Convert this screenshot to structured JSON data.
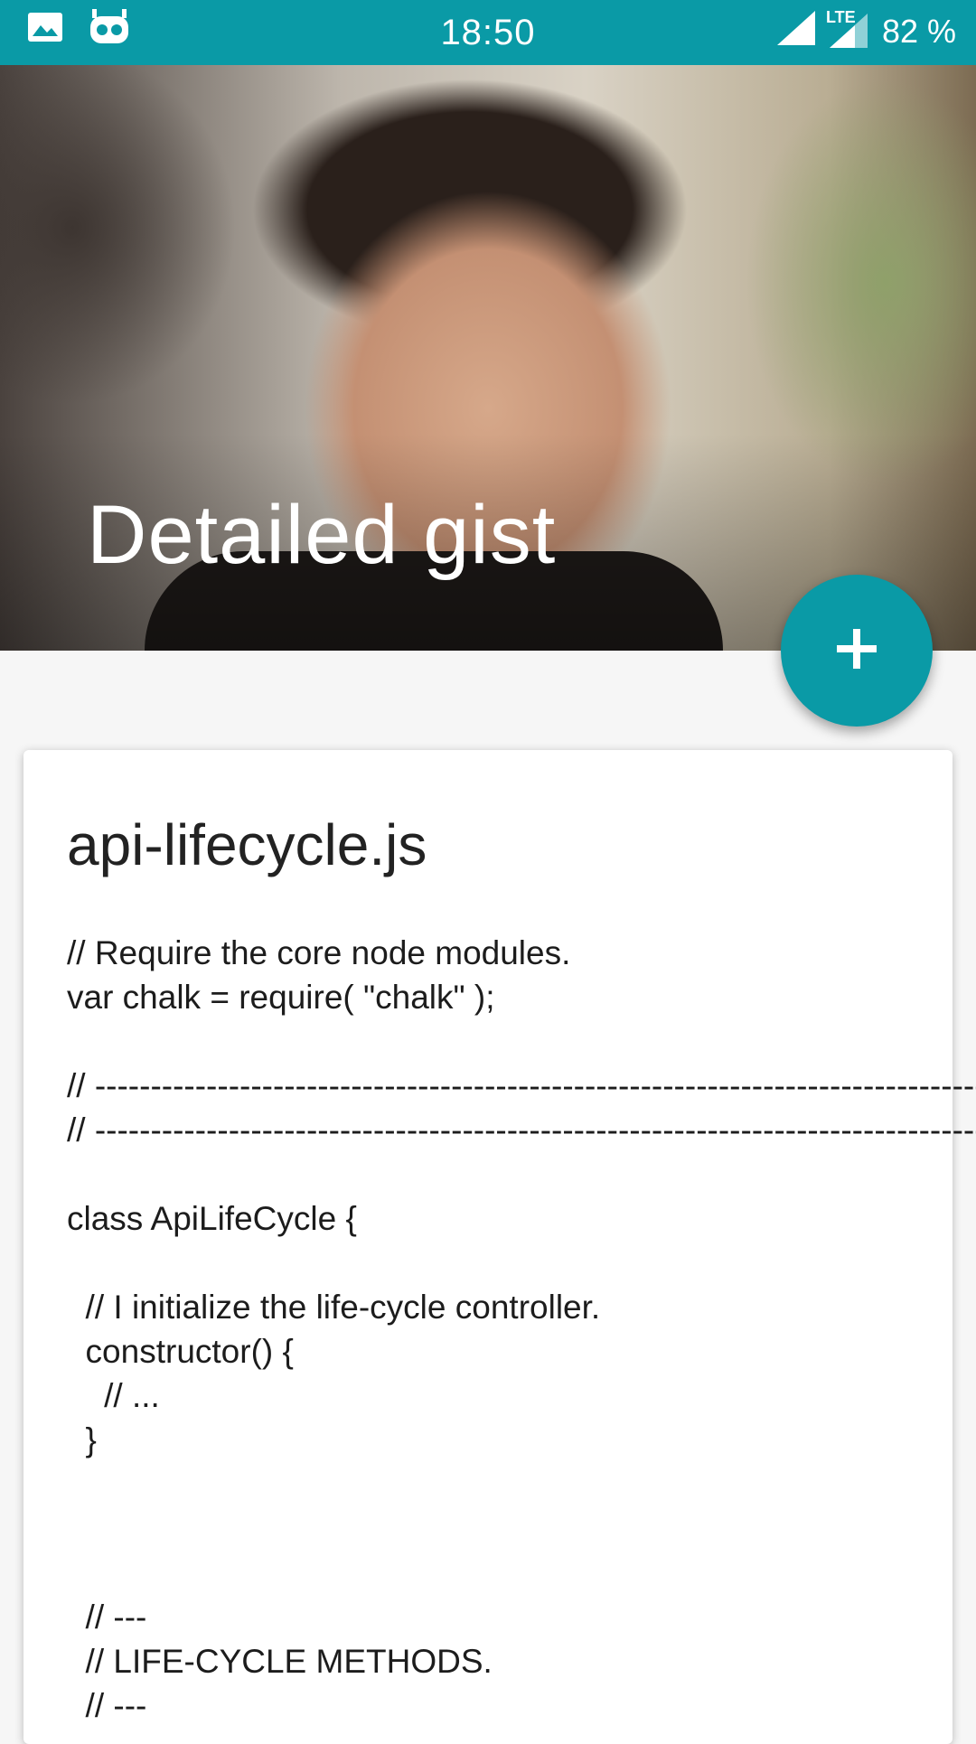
{
  "status_bar": {
    "time": "18:50",
    "network": "LTE",
    "battery": "82 %",
    "background_color": "#0a9aa6",
    "left_icons": [
      "image-icon",
      "robot-icon"
    ],
    "right_icons": [
      "signal-icon",
      "lte-signal-icon"
    ]
  },
  "hero": {
    "title": "Detailed gist"
  },
  "fab": {
    "icon": "plus-icon",
    "color": "#0a9aa6"
  },
  "card": {
    "title": "api-lifecycle.js",
    "code": "// Require the core node modules.\nvar chalk = require( \"chalk\" );\n\n// -------------------------------------------------------------------------------- //\n// -------------------------------------------------------------------------------- //\n\nclass ApiLifeCycle {\n\n  // I initialize the life-cycle controller.\n  constructor() {\n    // ...\n  }\n\n\n\n  // ---\n  // LIFE-CYCLE METHODS.\n  // ---"
  }
}
